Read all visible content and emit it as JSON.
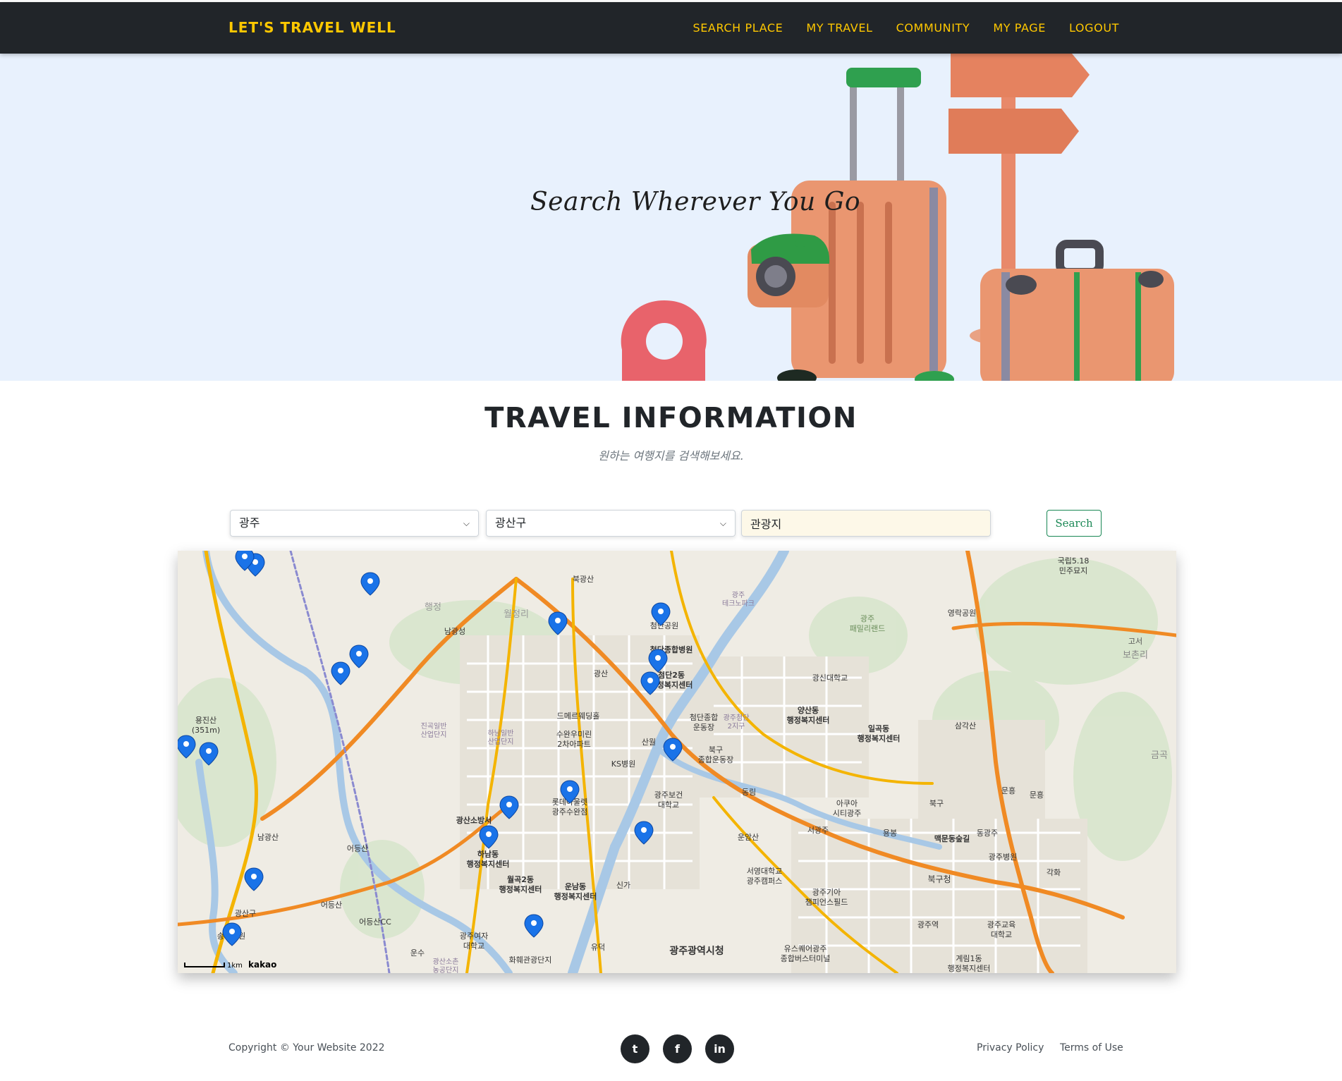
{
  "navbar": {
    "brand": "LET'S TRAVEL WELL",
    "links": [
      "SEARCH PLACE",
      "MY TRAVEL",
      "COMMUNITY",
      "MY PAGE",
      "LOGOUT"
    ],
    "bg_color": "#212529",
    "accent_color": "#ffc800"
  },
  "hero": {
    "title": "Search Wherever You Go",
    "bg_color": "#e8f1fd"
  },
  "section": {
    "heading": "TRAVEL INFORMATION",
    "subheading": "원하는 여행지를 검색해보세요."
  },
  "search": {
    "region_value": "광주",
    "district_value": "광산구",
    "keyword_value": "관광지",
    "button_label": "Search",
    "button_color": "#198754"
  },
  "map": {
    "provider_label": "kakao",
    "scale_label": "1km",
    "marker_color": "#1a73e8",
    "labels": {
      "l1": "국립5.18",
      "l2": "민주묘지",
      "l3": "영락공원",
      "l4": "고서",
      "l5": "보촌리",
      "l6": "광주",
      "l7": "패밀리랜드",
      "l8": "광주",
      "l9": "테크노파크",
      "l10": "북광산",
      "l11": "행정",
      "l12": "남광성",
      "l13": "월정리",
      "l14": "첨단공원",
      "l15": "첨단종합병원",
      "l16": "첨단2동",
      "l17": "행정복지센터",
      "l18": "광신대학교",
      "l19": "양산동",
      "l20": "행정복지센터",
      "l21": "일곡동",
      "l22": "행정복지센터",
      "l23": "삼각산",
      "l24": "광산",
      "l25": "드메르웨딩홀",
      "l26": "진곡일반",
      "l27": "산업단지",
      "l28": "하남일반",
      "l29": "산업단지",
      "l30": "수완우미린",
      "l31": "2차아파트",
      "l32": "첨단종합",
      "l33": "운동장",
      "l34": "광주첨단",
      "l35": "2지구",
      "l36": "산월",
      "l37": "북구",
      "l38": "종합운동장",
      "l39": "용진산",
      "l40": "(351m)",
      "l41": "KS병원",
      "l42": "광주보건",
      "l43": "대학교",
      "l44": "동림",
      "l45": "롯데아울렛",
      "l46": "광주수완점",
      "l47": "광산소방서",
      "l48": "아쿠아",
      "l49": "시티광주",
      "l50": "북구",
      "l51": "문흥",
      "l52": "문흥",
      "l53": "서광주",
      "l54": "용봉",
      "l55": "동광주",
      "l56": "맥문동숲길",
      "l57": "광주병원",
      "l58": "남광산",
      "l59": "어등산",
      "l60": "하남동",
      "l61": "행정복지센터",
      "l62": "운암산",
      "l63": "월곡2동",
      "l64": "행정복지센터",
      "l65": "운남동",
      "l66": "행정복지센터",
      "l67": "신가",
      "l68": "서영대학교",
      "l69": "광주캠퍼스",
      "l70": "북구청",
      "l71": "광주기아",
      "l72": "챔피언스필드",
      "l73": "각화",
      "l74": "어등산",
      "l75": "광산구",
      "l76": "어등산CC",
      "l77": "광주여자",
      "l78": "대학교",
      "l79": "광주역",
      "l80": "광주교육",
      "l81": "대학교",
      "l82": "송정공원",
      "l83": "운수",
      "l84": "광산소촌",
      "l85": "농공단지",
      "l86": "화훼관광단지",
      "l87": "유덕",
      "l88": "광주광역시청",
      "l89": "유스퀘어광주",
      "l90": "종합버스터미널",
      "l91": "계림1동",
      "l92": "행정복지센터",
      "l93": "금곡"
    }
  },
  "footer": {
    "copyright": "Copyright © Your Website 2022",
    "social": [
      {
        "name": "twitter",
        "glyph": "t"
      },
      {
        "name": "facebook",
        "glyph": "f"
      },
      {
        "name": "linkedin",
        "glyph": "in"
      }
    ],
    "links": [
      "Privacy Policy",
      "Terms of Use"
    ]
  }
}
